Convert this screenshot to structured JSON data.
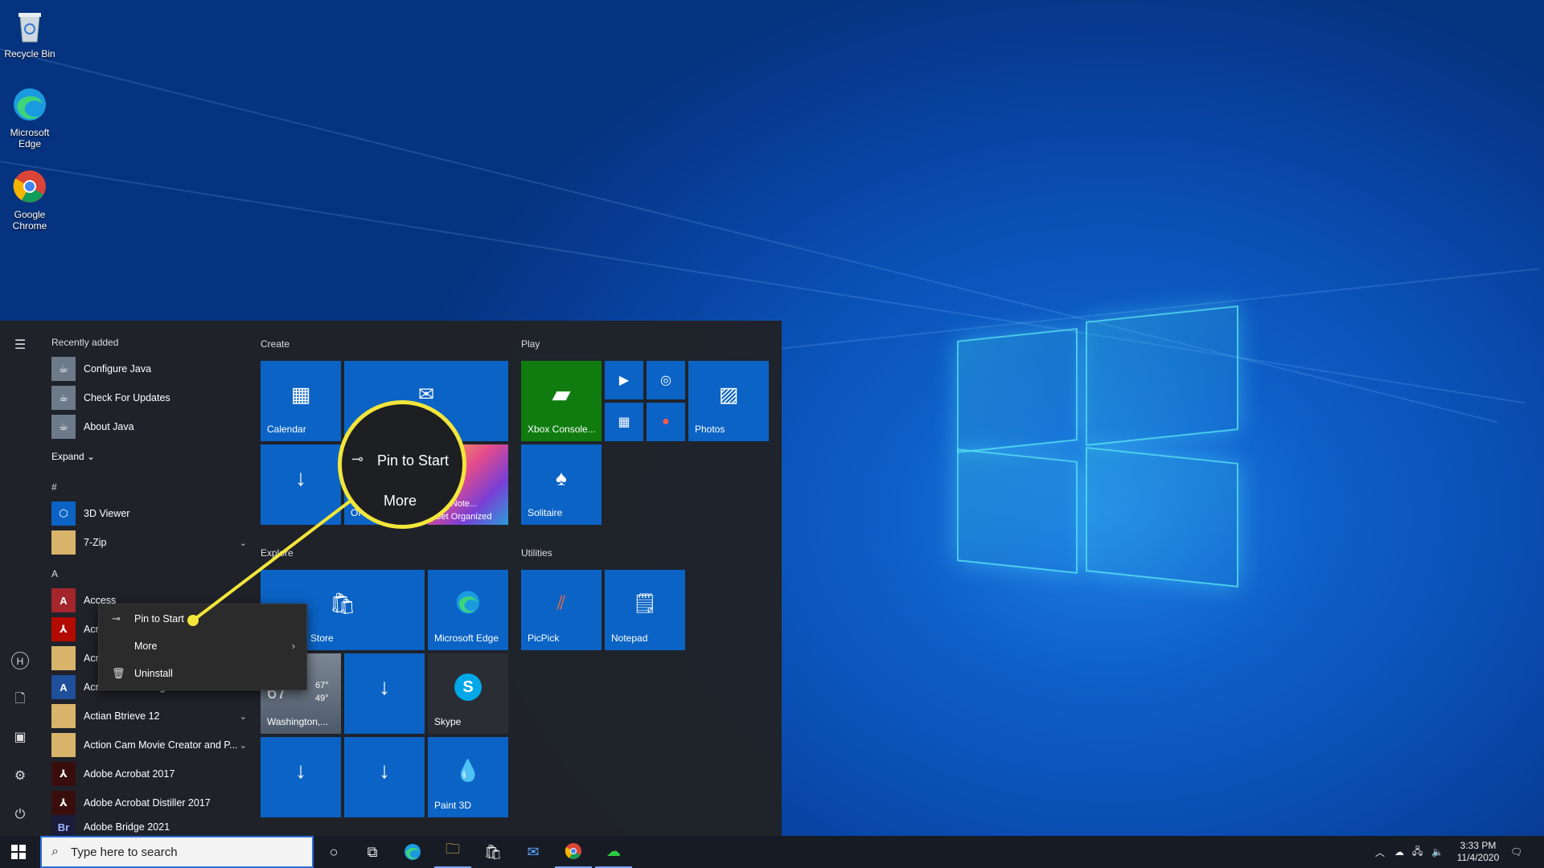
{
  "desktop": {
    "icons": [
      {
        "label": "Recycle Bin",
        "icon": "recycle-bin-icon"
      },
      {
        "label": "Microsoft Edge",
        "icon": "edge-icon"
      },
      {
        "label": "Google Chrome",
        "icon": "chrome-icon"
      }
    ]
  },
  "start_menu": {
    "recently_added_label": "Recently added",
    "recent": [
      "Configure Java",
      "Check For Updates",
      "About Java"
    ],
    "expand_label": "Expand",
    "hash_header": "#",
    "a_header": "A",
    "apps": [
      {
        "label": "3D Viewer",
        "icon": "3d-viewer-icon"
      },
      {
        "label": "7-Zip",
        "icon": "folder-icon",
        "expandable": true
      },
      {
        "label": "Access",
        "icon": "access-icon"
      },
      {
        "label": "Acro",
        "icon": "acrobat-icon"
      },
      {
        "label": "Acro",
        "icon": "folder-icon"
      },
      {
        "label": "Acronis True Image",
        "icon": "acronis-icon"
      },
      {
        "label": "Actian Btrieve 12",
        "icon": "folder-icon",
        "expandable": true
      },
      {
        "label": "Action Cam Movie Creator and P...",
        "icon": "folder-icon",
        "expandable": true
      },
      {
        "label": "Adobe Acrobat 2017",
        "icon": "acrobat-icon"
      },
      {
        "label": "Adobe Acrobat Distiller 2017",
        "icon": "acrobat-distiller-icon"
      },
      {
        "label": "Adobe Bridge 2021",
        "icon": "bridge-icon"
      }
    ],
    "groups": {
      "create": "Create",
      "play": "Play",
      "explore": "Explore",
      "utilities": "Utilities"
    },
    "tiles": {
      "calendar": "Calendar",
      "xbox": "Xbox Console...",
      "photos": "Photos",
      "solitaire": "Solitaire",
      "onenote": "OneNote...",
      "get_organized": "Get Organized",
      "office_partial": "Of",
      "store": "Store",
      "edge": "Microsoft Edge",
      "weather_city": "Washington,...",
      "weather_temp": "67",
      "weather_hi": "67°",
      "weather_lo": "49°",
      "skype": "Skype",
      "paint3d": "Paint 3D",
      "picpick": "PicPick",
      "notepad": "Notepad"
    }
  },
  "context_menu": {
    "pin": "Pin to Start",
    "more": "More",
    "uninstall": "Uninstall"
  },
  "callout": {
    "pin": "Pin to Start",
    "more": "More"
  },
  "taskbar": {
    "search_placeholder": "Type here to search",
    "time": "3:33 PM",
    "date": "11/4/2020"
  },
  "colors": {
    "accent": "#0b63c5",
    "highlight": "#f3e63a",
    "menu_bg": "#202226"
  }
}
